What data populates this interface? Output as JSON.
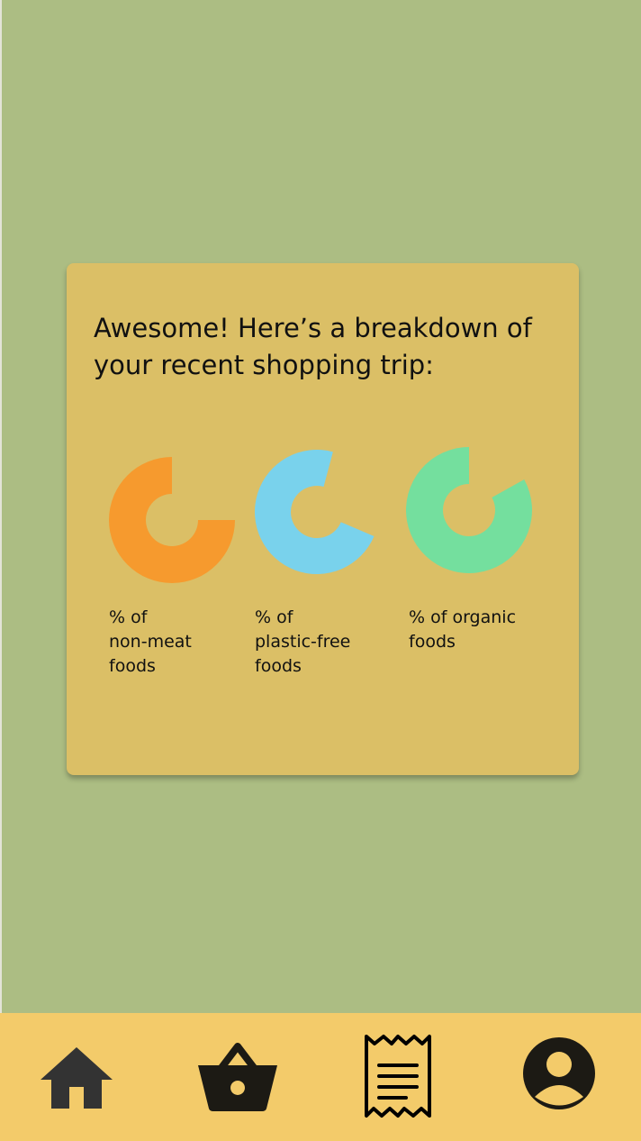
{
  "card": {
    "heading": "Awesome! Here’s a breakdown of your recent shopping trip:",
    "stats": [
      {
        "label_lines": [
          "% of",
          "non-meat",
          "foods"
        ],
        "color": "#f69a2e",
        "gap_from_deg": 0,
        "gap_to_deg": 90
      },
      {
        "label_lines": [
          "% of",
          "plastic-free",
          "foods"
        ],
        "color": "#79d2ec",
        "gap_from_deg": 15,
        "gap_to_deg": 113
      },
      {
        "label_lines": [
          "% of organic",
          "foods"
        ],
        "color": "#74df9e",
        "gap_from_deg": 0,
        "gap_to_deg": 61
      }
    ]
  },
  "nav": {
    "items": [
      {
        "icon": "home-icon",
        "color": "#333333"
      },
      {
        "icon": "basket-icon",
        "color": "#1c1a14"
      },
      {
        "icon": "receipt-icon",
        "color": "#000000"
      },
      {
        "icon": "profile-icon",
        "color": "#1c1a14"
      }
    ]
  }
}
